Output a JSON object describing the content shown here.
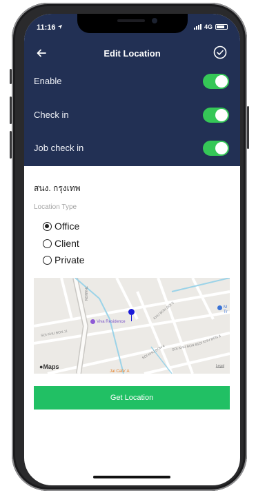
{
  "status_bar": {
    "time": "11:16",
    "network": "4G"
  },
  "navbar": {
    "title": "Edit Location",
    "back_icon": "back-arrow-icon",
    "confirm_icon": "check-circle-icon"
  },
  "toggles": [
    {
      "label": "Enable",
      "on": true
    },
    {
      "label": "Check in",
      "on": true
    },
    {
      "label": "Job check in",
      "on": true
    }
  ],
  "location_name": "สนง. กรุงเทพ",
  "location_type": {
    "label": "Location Type",
    "options": [
      "Office",
      "Client",
      "Private"
    ],
    "selected": "Office"
  },
  "map": {
    "street_labels": [
      "THANON",
      "SOI KHU BON 11",
      "SOI KHU BON 6",
      "KHU BON SOI 3",
      "SOI KHU BON 8",
      "SOI KHU BON 4"
    ],
    "poi_primary": "Viva Residence",
    "poi_secondary": "M",
    "poi_secondary_sub": "Tr",
    "cafe": "Jai Cafe' A",
    "attribution": "Maps",
    "legal": "Legal"
  },
  "actions": {
    "get_location": "Get Location"
  },
  "colors": {
    "header": "#223054",
    "toggle_on": "#35c757",
    "primary_button": "#21c064",
    "pin": "#1a1ad8"
  }
}
